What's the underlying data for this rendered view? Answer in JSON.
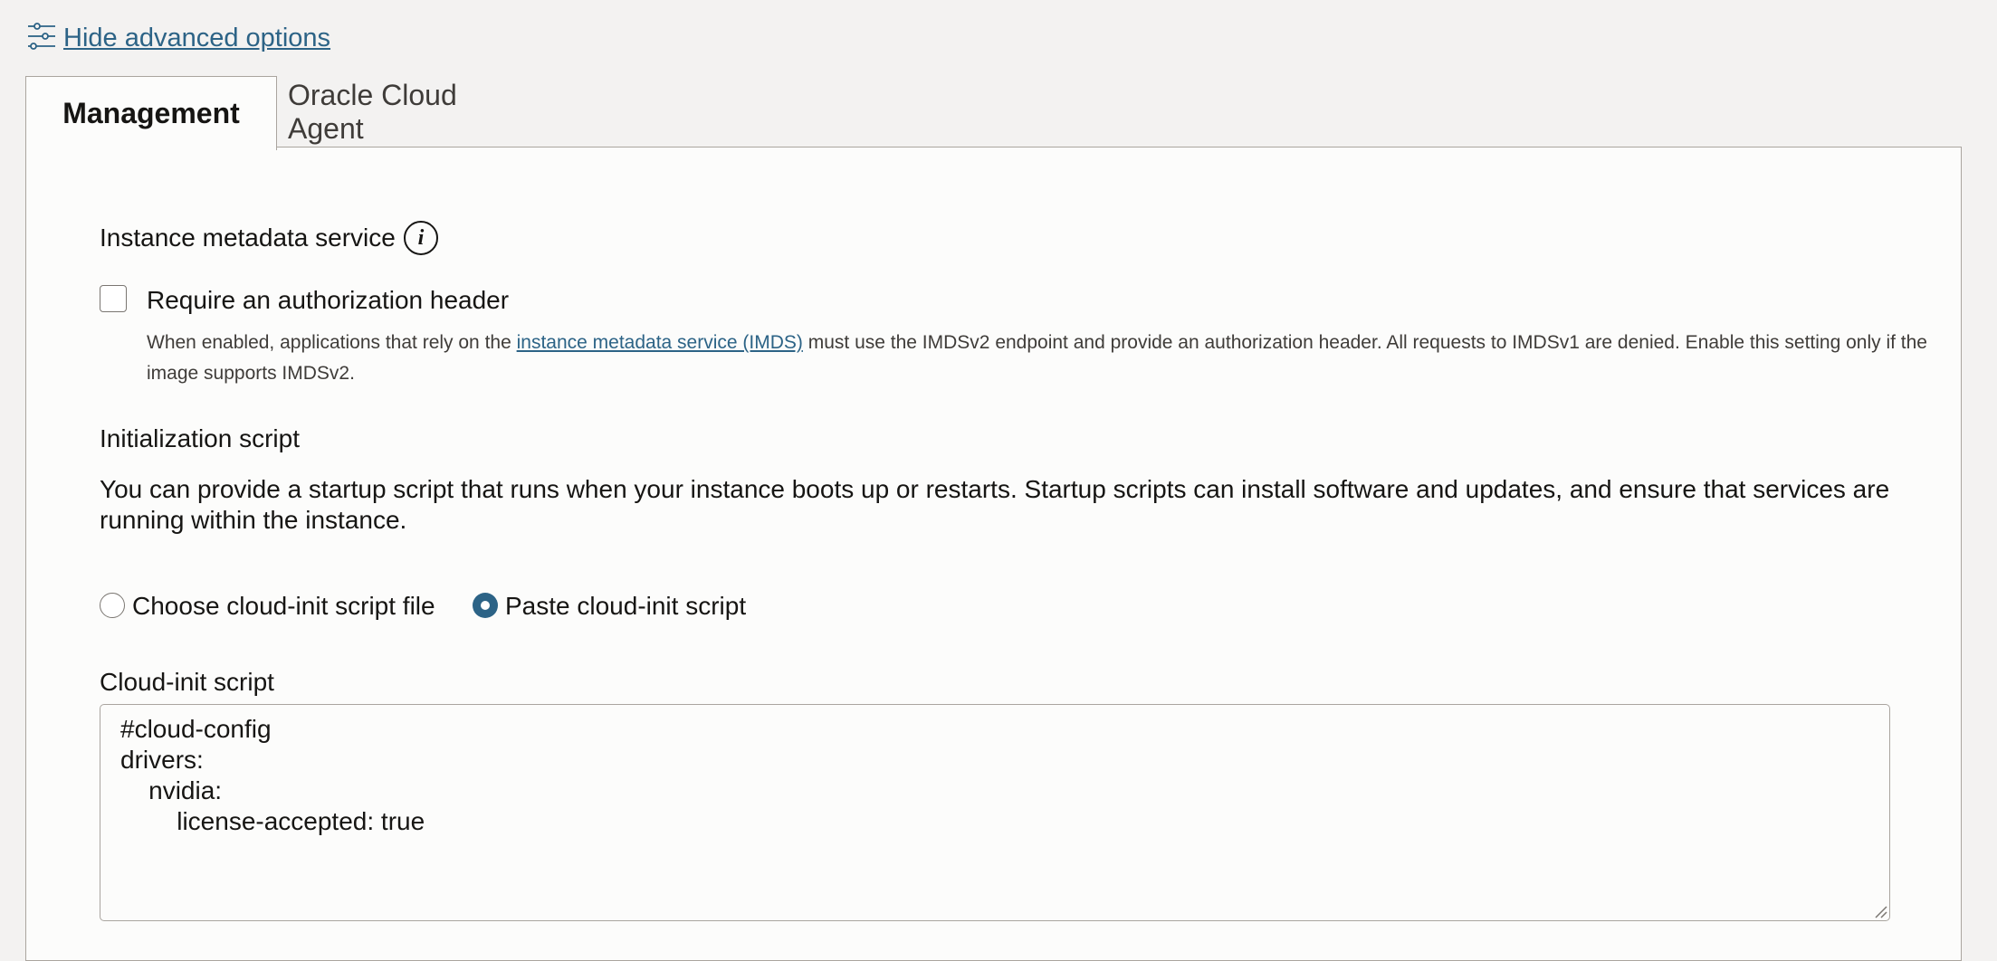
{
  "advanced": {
    "toggle_label": "Hide advanced options",
    "icon": "sliders-icon"
  },
  "tabs": [
    {
      "label": "Management",
      "active": true
    },
    {
      "label": "Oracle Cloud Agent",
      "active": false
    }
  ],
  "imds": {
    "title": "Instance metadata service",
    "info_icon": "i",
    "checkbox_label": "Require an authorization header",
    "checkbox_checked": false,
    "help_before": "When enabled, applications that rely on the ",
    "help_link": "instance metadata service (IMDS)",
    "help_after": " must use the IMDSv2 endpoint and provide an authorization header. All requests to IMDSv1 are denied. Enable this setting only if the image supports IMDSv2."
  },
  "init_script": {
    "title": "Initialization script",
    "description": "You can provide a startup script that runs when your instance boots up or restarts. Startup scripts can install software and updates, and ensure that services are running within the instance.",
    "options": [
      {
        "label": "Choose cloud-init script file",
        "selected": false
      },
      {
        "label": "Paste cloud-init script",
        "selected": true
      }
    ],
    "field_label": "Cloud-init script",
    "field_value": "#cloud-config\ndrivers:\n    nvidia:\n        license-accepted: true"
  },
  "colors": {
    "link": "#2c6386",
    "background": "#f3f2f1",
    "panel": "#fcfcfb"
  }
}
